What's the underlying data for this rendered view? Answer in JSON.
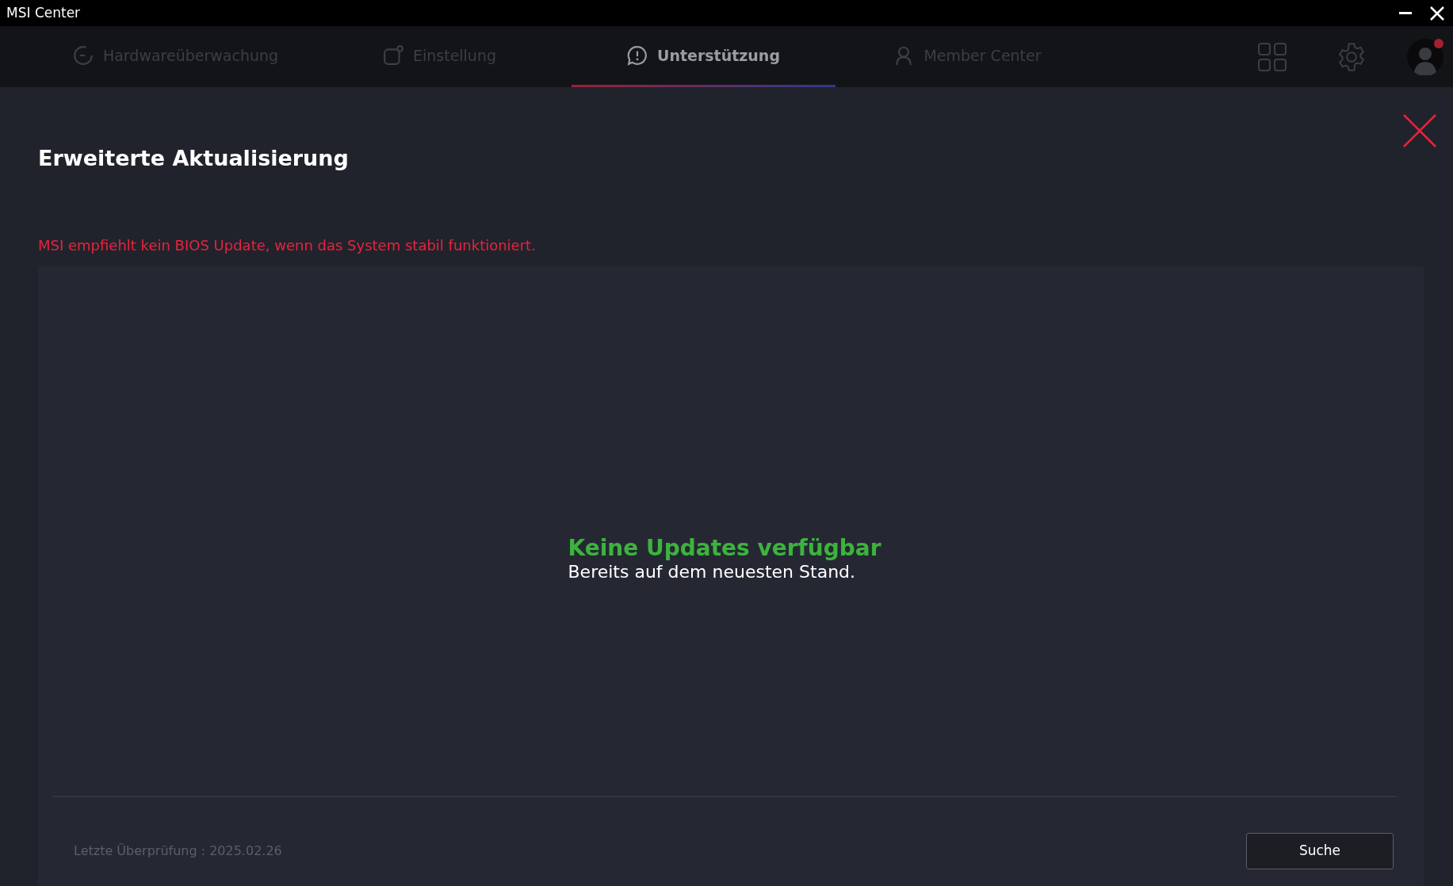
{
  "window": {
    "title": "MSI Center"
  },
  "tabs": [
    {
      "label": "Hardwareüberwachung",
      "selected": false
    },
    {
      "label": "Einstellung",
      "selected": false
    },
    {
      "label": "Unterstützung",
      "selected": true
    },
    {
      "label": "Member Center",
      "selected": false
    }
  ],
  "profile": {
    "notification": true
  },
  "page": {
    "title": "Erweiterte Aktualisierung",
    "warning": "MSI empfiehlt kein BIOS Update, wenn das System stabil funktioniert.",
    "status_title": "Keine Updates verfügbar",
    "status_text": "Bereits auf dem neuesten Stand.",
    "last_check": "Letzte Überprüfung : 2025.02.26",
    "button": "Suche"
  }
}
